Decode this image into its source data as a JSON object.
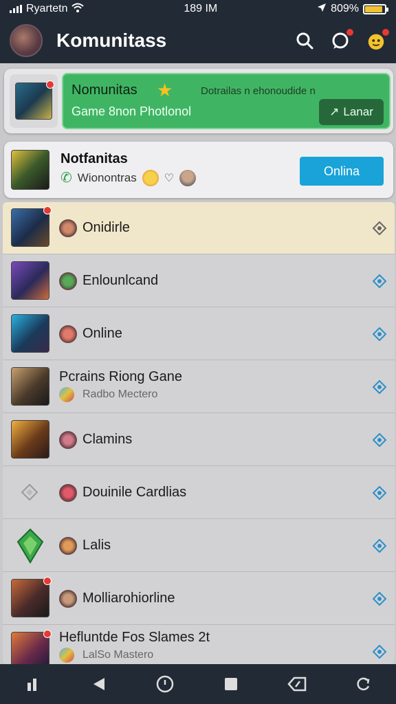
{
  "status": {
    "carrier": "Ryartetn",
    "time": "189 IM",
    "battery": "809%",
    "battery_level": 0.9
  },
  "appbar": {
    "title": "Komunitass",
    "icons": [
      "search-icon",
      "chat-icon",
      "notification-avatar-icon"
    ]
  },
  "promo": {
    "title": "Nomunitas",
    "right_text": "Dotrailas n ehonoudide n",
    "subtitle": "Game 8non Photlonol",
    "button_label": "Lanar",
    "colors": {
      "bg": "#3fb564",
      "button": "#27683b"
    }
  },
  "notification": {
    "title": "Notfanitas",
    "subtitle": "Wionontras",
    "button_label": "Onlina",
    "button_color": "#1aa3d9"
  },
  "list": {
    "items": [
      {
        "title": "Onidirle",
        "subtitle": ""
      },
      {
        "title": "Enlounlcand",
        "subtitle": ""
      },
      {
        "title": "Online",
        "subtitle": ""
      },
      {
        "title": "Pcrains Riong Gane",
        "subtitle": "Radbo Mectero"
      },
      {
        "title": "Clamins",
        "subtitle": ""
      },
      {
        "title": "Douinile Cardlias",
        "subtitle": ""
      },
      {
        "title": "Lalis",
        "subtitle": ""
      },
      {
        "title": "Molliarohiorline",
        "subtitle": ""
      },
      {
        "title": "Hefluntde Fos Slames 2t",
        "subtitle": "LalSo Mastero"
      }
    ]
  },
  "navbar": {
    "icons": [
      "bars-icon",
      "back-icon",
      "home-icon",
      "recent-icon",
      "tag-icon",
      "refresh-icon"
    ]
  }
}
